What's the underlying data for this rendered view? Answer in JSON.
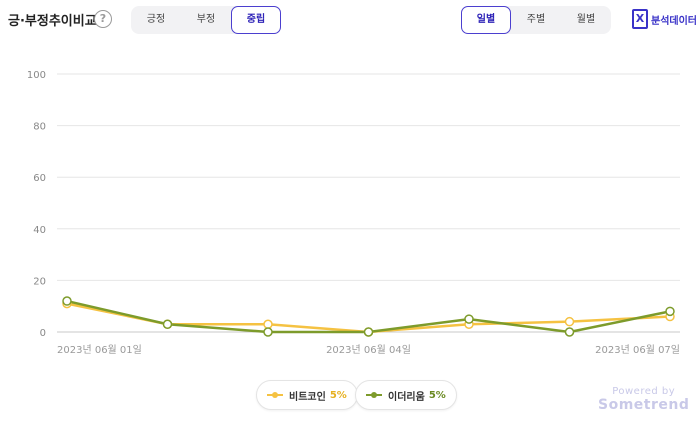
{
  "header": {
    "title": "긍·부정추이비교",
    "help_icon": "?",
    "sentiment_tabs": [
      {
        "label": "긍정",
        "active": false
      },
      {
        "label": "부정",
        "active": false
      },
      {
        "label": "중립",
        "active": true
      }
    ],
    "period_tabs": [
      {
        "label": "일별",
        "active": true
      },
      {
        "label": "주별",
        "active": false
      },
      {
        "label": "월별",
        "active": false
      }
    ],
    "analysis_button": {
      "icon": "X",
      "label": "분석데이터"
    }
  },
  "chart_data": {
    "type": "line",
    "x": [
      "2023년 06월 01일",
      "2023년 06월 02일",
      "2023년 06월 03일",
      "2023년 06월 04일",
      "2023년 06월 05일",
      "2023년 06월 06일",
      "2023년 06월 07일"
    ],
    "x_tick_labels": [
      "2023년 06월 01일",
      "2023년 06월 04일",
      "2023년 06월 07일"
    ],
    "ylim": [
      0,
      100
    ],
    "y_ticks": [
      "0",
      "20",
      "40",
      "60",
      "80",
      "100"
    ],
    "grid": true,
    "series": [
      {
        "name": "비트코인",
        "share": "5%",
        "color": "#f5c242",
        "values": [
          11,
          3,
          3,
          0,
          3,
          4,
          6
        ]
      },
      {
        "name": "이더리움",
        "share": "5%",
        "color": "#7d9b2b",
        "values": [
          12,
          3,
          0,
          0,
          5,
          0,
          8
        ]
      }
    ]
  },
  "footer": {
    "powered_by": "Powered by",
    "brand": "Sometrend"
  }
}
